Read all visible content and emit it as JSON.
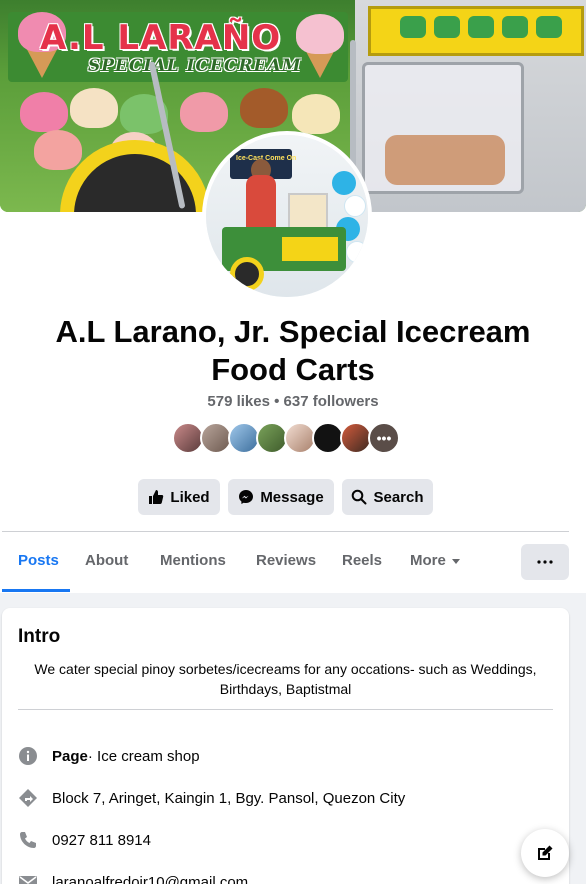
{
  "cover": {
    "sign_title": "A.L LARAÑO",
    "sign_subtitle": "SPECIAL ICECREAM"
  },
  "avatar": {
    "banner_text": "Ice-Cast Come On"
  },
  "page": {
    "title_line1": "A.L Larano, Jr. Special Icecream",
    "title_line2": "Food Carts",
    "stats": "579 likes • 637 followers"
  },
  "actions": {
    "liked": "Liked",
    "message": "Message",
    "search": "Search"
  },
  "tabs": {
    "posts": "Posts",
    "about": "About",
    "mentions": "Mentions",
    "reviews": "Reviews",
    "reels": "Reels",
    "more": "More"
  },
  "intro": {
    "title": "Intro",
    "bio": "We cater special pinoy sorbetes/icecreams for any occations- such as Weddings, Birthdays, Baptistmal",
    "page_label": "Page",
    "page_category": " · Ice cream shop",
    "address": "Block 7, Aringet, Kaingin 1, Bgy. Pansol, Quezon City",
    "phone": "0927 811 8914",
    "email": "laranoalfredojr10@gmail.com"
  },
  "colors": {
    "accent": "#1877f2",
    "secondary_text": "#65676b",
    "button_bg": "#e4e6eb"
  },
  "icons": [
    "like-icon",
    "messenger-icon",
    "search-icon",
    "more-dots-icon",
    "info-icon",
    "directions-icon",
    "phone-icon",
    "email-icon",
    "compose-icon",
    "caret-down-icon"
  ]
}
